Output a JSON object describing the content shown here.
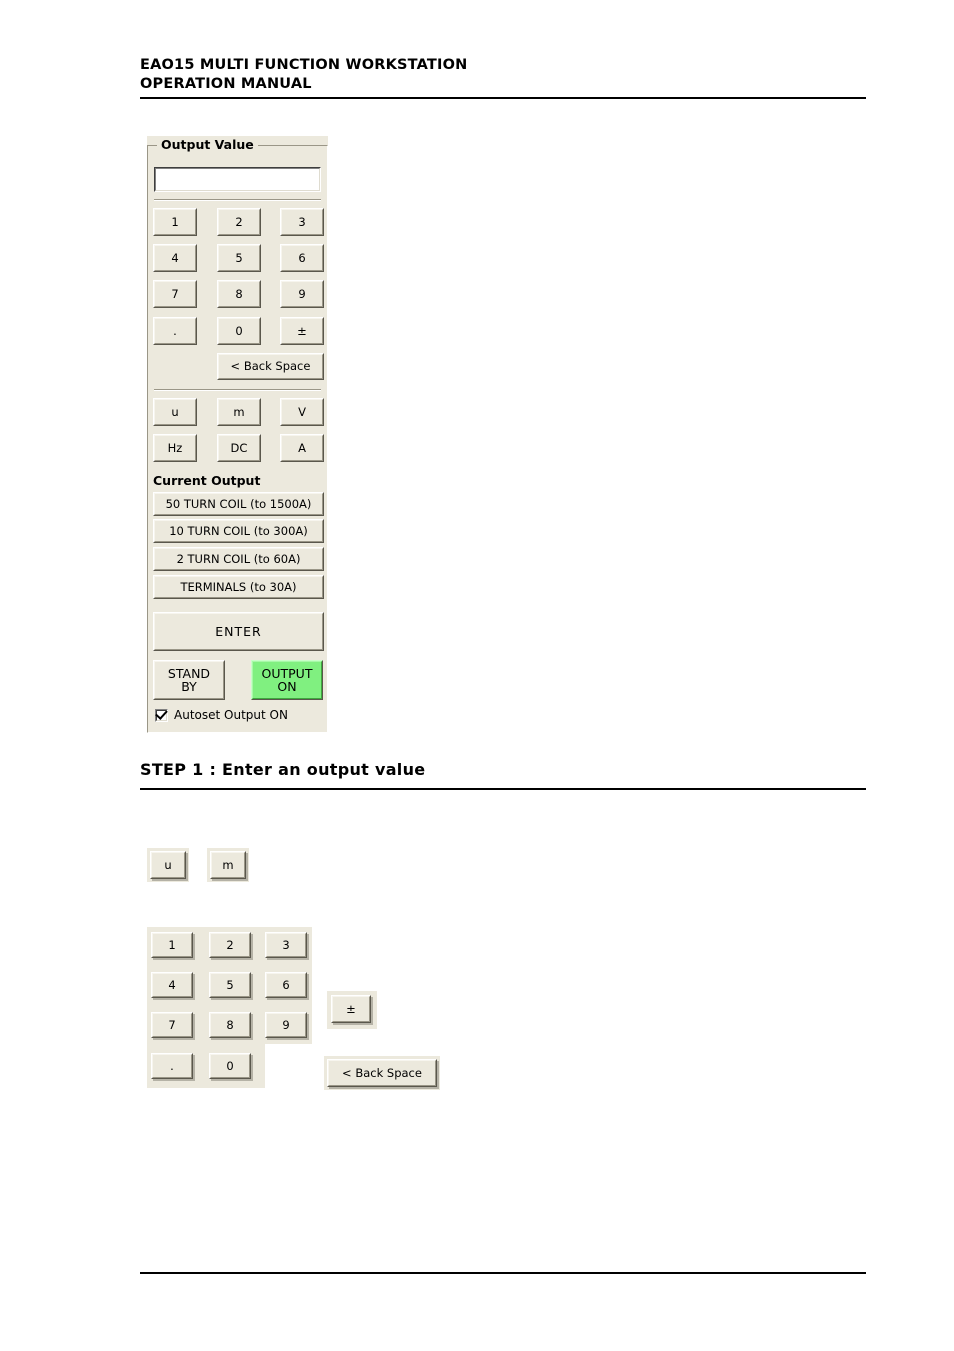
{
  "header": {
    "line1": "EAO15 MULTI FUNCTION WORKSTATION",
    "line2": "OPERATION MANUAL"
  },
  "step": {
    "heading": "STEP 1 : Enter an output value"
  },
  "panel": {
    "group_title": "Output Value",
    "display_value": "",
    "display_placeholder": "",
    "keypad": [
      [
        "1",
        "2",
        "3"
      ],
      [
        "4",
        "5",
        "6"
      ],
      [
        "7",
        "8",
        "9"
      ],
      [
        ".",
        "0",
        "±"
      ]
    ],
    "backspace_label": "< Back Space",
    "units_row1": [
      "u",
      "m",
      "V"
    ],
    "units_row2": [
      "Hz",
      "DC",
      "A"
    ],
    "current_output_label": "Current Output",
    "range_buttons": [
      "50 TURN COIL (to 1500A)",
      "10 TURN COIL (to 300A)",
      "2 TURN COIL (to 60A)",
      "TERMINALS (to 30A)"
    ],
    "enter_label": "ENTER",
    "standby_label": "STAND\nBY",
    "output_on_label": "OUTPUT\nON",
    "output_on_color": "#80F080",
    "autoset_label": "Autoset Output ON",
    "autoset_checked": true
  },
  "demo_units": {
    "buttons": [
      "u",
      "m"
    ]
  },
  "demo_keypad": {
    "rows": [
      [
        "1",
        "2",
        "3"
      ],
      [
        "4",
        "5",
        "6"
      ],
      [
        "7",
        "8",
        "9"
      ],
      [
        ".",
        "0"
      ]
    ],
    "plusminus_label": "±",
    "backspace_label": "< Back Space"
  }
}
